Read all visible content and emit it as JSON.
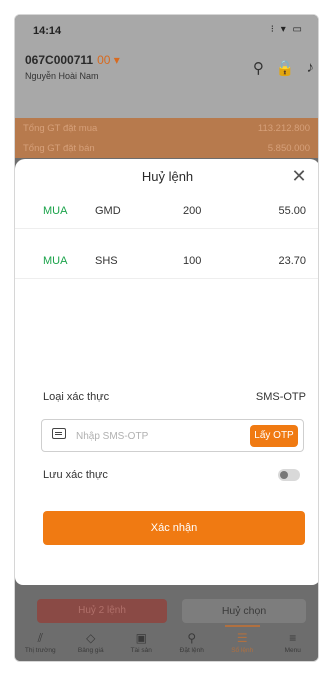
{
  "status_bar": {
    "time": "14:14",
    "indicators": "⁝ ▾ ▭"
  },
  "header": {
    "account_id": "067C000711",
    "account_suffix": "00 ▾",
    "user_name": "Nguyễn Hoài Nam",
    "icons": [
      "search-icon",
      "lock-icon",
      "bell-icon"
    ]
  },
  "summary": [
    {
      "label": "Tổng GT đặt mua",
      "value": "113.212.800"
    },
    {
      "label": "Tổng GT đặt bán",
      "value": "5.850.000"
    }
  ],
  "sheet": {
    "title": "Huỷ lệnh",
    "close": "✕",
    "orders": [
      {
        "side": "MUA",
        "symbol": "GMD",
        "quantity": "200",
        "price": "55.00"
      },
      {
        "side": "MUA",
        "symbol": "SHS",
        "quantity": "100",
        "price": "23.70"
      }
    ],
    "auth_type_label": "Loại xác thực",
    "auth_type_value": "SMS-OTP",
    "otp_placeholder": "Nhập SMS-OTP",
    "get_otp_label": "Lấy OTP",
    "save_auth_label": "Lưu xác thực",
    "confirm_label": "Xác nhận"
  },
  "actions": {
    "cancel_orders": "Huỷ 2 lệnh",
    "cancel_selection": "Huỷ chọn"
  },
  "nav": [
    {
      "icon": "market-icon",
      "glyph": "⫽",
      "label": "Thị trường"
    },
    {
      "icon": "price-board-icon",
      "glyph": "◇",
      "label": "Bảng giá"
    },
    {
      "icon": "assets-icon",
      "glyph": "▣",
      "label": "Tài sản"
    },
    {
      "icon": "place-order-icon",
      "glyph": "⚲",
      "label": "Đặt lệnh"
    },
    {
      "icon": "order-book-icon",
      "glyph": "☰",
      "label": "Sổ lệnh"
    },
    {
      "icon": "menu-icon",
      "glyph": "≡",
      "label": "Menu"
    }
  ],
  "colors": {
    "accent": "#f07a12",
    "buy": "#1aa34a"
  }
}
